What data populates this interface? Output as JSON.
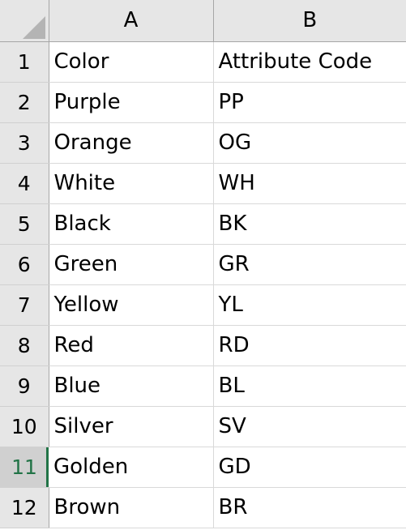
{
  "app": {
    "type": "spreadsheet",
    "select_all_label": "",
    "corner_icon": "select-all-triangle-icon"
  },
  "colors": {
    "header_background": "#E6E6E6",
    "header_border": "#A6A6A6",
    "gridline": "#D9D9D9",
    "active_accent": "#217346",
    "active_row_header_background": "#D0D0D0",
    "cell_background": "#FFFFFF",
    "text": "#000000"
  },
  "columns": [
    {
      "id": "A",
      "label": "A"
    },
    {
      "id": "B",
      "label": "B"
    }
  ],
  "active_row": 11,
  "rows": [
    {
      "number": "1",
      "a": "Color",
      "b": "Attribute Code"
    },
    {
      "number": "2",
      "a": "Purple",
      "b": "PP"
    },
    {
      "number": "3",
      "a": "Orange",
      "b": "OG"
    },
    {
      "number": "4",
      "a": "White",
      "b": "WH"
    },
    {
      "number": "5",
      "a": "Black",
      "b": "BK"
    },
    {
      "number": "6",
      "a": "Green",
      "b": "GR"
    },
    {
      "number": "7",
      "a": "Yellow",
      "b": "YL"
    },
    {
      "number": "8",
      "a": "Red",
      "b": "RD"
    },
    {
      "number": "9",
      "a": "Blue",
      "b": "BL"
    },
    {
      "number": "10",
      "a": "Silver",
      "b": "SV"
    },
    {
      "number": "11",
      "a": "Golden",
      "b": "GD"
    },
    {
      "number": "12",
      "a": "Brown",
      "b": "BR"
    }
  ]
}
